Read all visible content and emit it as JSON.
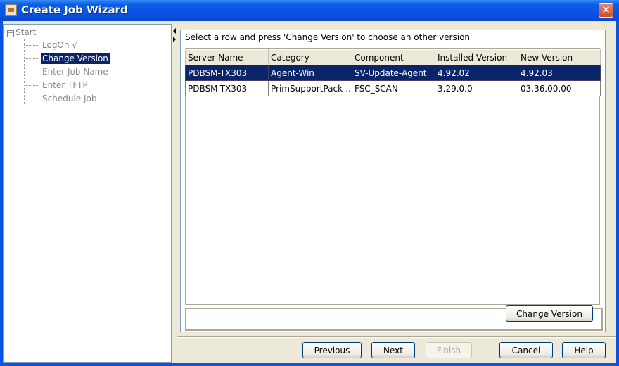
{
  "window": {
    "title": "Create Job Wizard",
    "close_label": "✕"
  },
  "tree": {
    "root_label": "Start",
    "toggle_symbol": "−",
    "items": [
      {
        "label": "LogOn √"
      },
      {
        "label": "Change Version"
      },
      {
        "label": "Enter Job Name"
      },
      {
        "label": "Enter TFTP"
      },
      {
        "label": "Schedule Job"
      }
    ]
  },
  "main": {
    "instruction": "Select a row and press 'Change Version' to choose an other version",
    "columns": [
      "Server Name",
      "Category",
      "Component",
      "Installed Version",
      "New Version"
    ],
    "rows": [
      [
        "PDBSM-TX303",
        "Agent-Win",
        "SV-Update-Agent",
        "4.92.02",
        "4.92.03"
      ],
      [
        "PDBSM-TX303",
        "PrimSupportPack-...",
        "FSC_SCAN",
        "3.29.0.0",
        "03.36.00.00"
      ]
    ],
    "change_version_label": "Change Version"
  },
  "footer": {
    "previous_label": "Previous",
    "next_label": "Next",
    "finish_label": "Finish",
    "cancel_label": "Cancel",
    "help_label": "Help"
  },
  "colors": {
    "title_bar": "#0a54e4",
    "selection": "#0a246a",
    "window_background": "#ece9d8"
  }
}
